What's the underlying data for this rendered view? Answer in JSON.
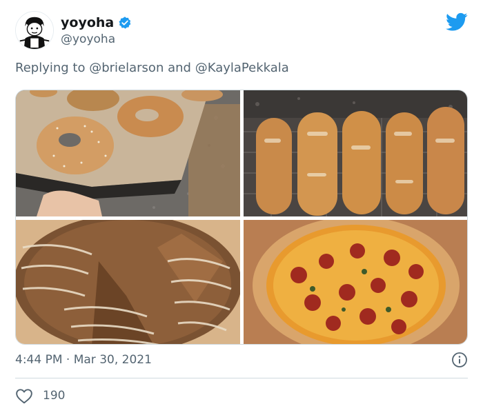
{
  "user": {
    "display_name": "yoyoha",
    "handle": "@yoyoha",
    "avatar_icon": "cartoon-avatar-icon",
    "verified_icon": "verified-badge-icon"
  },
  "brand": {
    "logo_icon": "twitter-bird-icon",
    "accent": "#1d9bf0"
  },
  "reply": {
    "prefix": "Replying to",
    "mention_1": "@brielarson",
    "joiner": "and",
    "mention_2": "@KaylaPekkala"
  },
  "media": {
    "images": [
      {
        "name": "bagels-photo"
      },
      {
        "name": "baguettes-photo"
      },
      {
        "name": "sourdough-loaf-photo"
      },
      {
        "name": "pepperoni-pizza-photo"
      }
    ]
  },
  "meta": {
    "time": "4:44 PM",
    "separator": "·",
    "date": "Mar 30, 2021",
    "info_icon": "info-icon"
  },
  "stats": {
    "like_icon": "heart-icon",
    "likes": "190"
  }
}
